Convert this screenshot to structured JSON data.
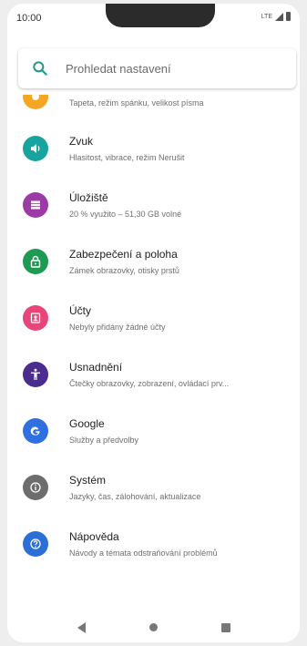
{
  "status": {
    "time": "10:00",
    "network": "LTE"
  },
  "search": {
    "placeholder": "Prohledat nastavení"
  },
  "items": [
    {
      "title": "",
      "subtitle": "Tapeta, režim spánku, velikost písma",
      "icon": "display-icon",
      "color": "#f5a623"
    },
    {
      "title": "Zvuk",
      "subtitle": "Hlasitost, vibrace, režim Nerušit",
      "icon": "volume-icon",
      "color": "#17a3a0"
    },
    {
      "title": "Úložiště",
      "subtitle": "20 % využito – 51,30 GB volné",
      "icon": "storage-icon",
      "color": "#9c3aa8"
    },
    {
      "title": "Zabezpečení a poloha",
      "subtitle": "Zámek obrazovky, otisky prstů",
      "icon": "lock-icon",
      "color": "#1f9a52"
    },
    {
      "title": "Účty",
      "subtitle": "Nebyly přidány žádné účty",
      "icon": "account-icon",
      "color": "#e8457a"
    },
    {
      "title": "Usnadnění",
      "subtitle": "Čtečky obrazovky, zobrazení, ovládací prv...",
      "icon": "accessibility-icon",
      "color": "#4a2d8f"
    },
    {
      "title": "Google",
      "subtitle": "Služby a předvolby",
      "icon": "google-icon",
      "color": "#2f6fe0"
    },
    {
      "title": "Systém",
      "subtitle": "Jazyky, čas, zálohování, aktualizace",
      "icon": "info-icon",
      "color": "#6d6d6d"
    },
    {
      "title": "Nápověda",
      "subtitle": "Návody a témata odstraňování problémů",
      "icon": "help-icon",
      "color": "#2b6fd6"
    }
  ]
}
